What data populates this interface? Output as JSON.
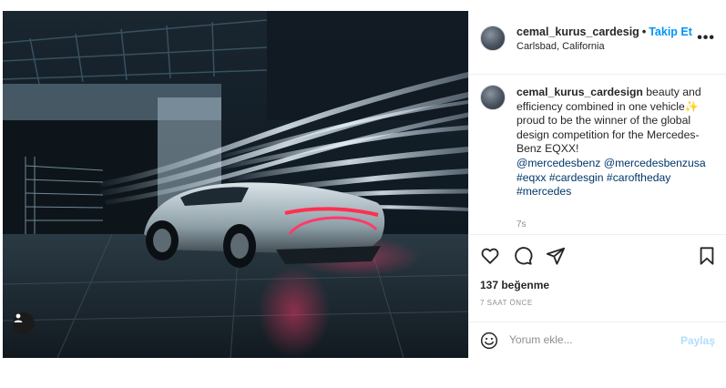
{
  "post": {
    "header": {
      "username": "cemal_kurus_cardesig",
      "separator": "•",
      "follow_label": "Takip Et",
      "location": "Carlsbad, California",
      "more_label": "•••"
    },
    "caption": {
      "username": "cemal_kurus_cardesign",
      "text": "beauty and efficiency combined in one vehicle✨ proud to be the winner of the global design competition for the Mercedes-Benz EQXX!",
      "tags": "@mercedesbenz @mercedesbenzusa #eqxx #cardesgin #caroftheday #mercedes",
      "time_ago": "7s"
    },
    "actions": {
      "icons": [
        "heart-icon",
        "comment-icon",
        "share-icon",
        "bookmark-icon"
      ],
      "likes": "137 beğenme",
      "posted": "7 SAAT ÖNCE"
    },
    "comment": {
      "placeholder": "Yorum ekle...",
      "share_label": "Paylaş",
      "emoji_icon": "smiley-icon"
    },
    "media": {
      "tag_icon": "user-tag-icon"
    }
  },
  "colors": {
    "accent": "#0095f6",
    "link": "#00376b",
    "muted": "#8e8e8e",
    "share_disabled": "#b2dffc"
  }
}
